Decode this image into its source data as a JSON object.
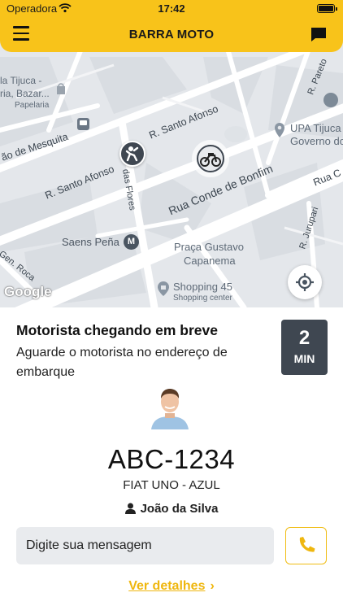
{
  "status_bar": {
    "carrier": "Operadora",
    "time": "17:42"
  },
  "header": {
    "title": "BARRA MOTO",
    "menu_icon": "hamburger-menu-icon",
    "chat_icon": "chat-bubble-icon",
    "color": "#f8c31a"
  },
  "map": {
    "labels": {
      "tijuca_bazar": "la Tijuca -",
      "tijuca_bazar2": "ria, Bazar...",
      "papelaria": "Papelaria",
      "mesquita": "ão de Mesquita",
      "santo_afonso_1": "R. Santo Afonso",
      "santo_afonso_2": "R. Santo Afonso",
      "das_flores": "das Flores",
      "conde_bonfim": "Rua Conde de Bonfim",
      "upa_1": "UPA Tijuca",
      "upa_2": "Governo do",
      "pareto": "R. Pareto",
      "rua_c": "Rua C",
      "jurupari": "R. Jurupari",
      "saens_pena": "Saens Peña",
      "metro_badge": "M",
      "gen_roca": "Gen. Roca",
      "praca_1": "Praça Gustavo",
      "praca_2": "Capanema",
      "shopping": "Shopping 45",
      "shopping_center": "Shopping center",
      "google": "Google"
    },
    "icons": [
      "bus-stop-icon",
      "passenger-pin-icon",
      "motorcycle-pin-icon",
      "location-pin-icon",
      "shopping-bag-icon",
      "metro-icon",
      "locate-me-icon"
    ]
  },
  "ride": {
    "status_title": "Motorista chegando em breve",
    "status_subtitle": "Aguarde o motorista no endereço de embarque",
    "eta_value": "2",
    "eta_unit": "MIN",
    "plate": "ABC-1234",
    "vehicle": "FIAT UNO - AZUL",
    "driver_name": "João da Silva"
  },
  "message": {
    "placeholder": "Digite sua mensagem"
  },
  "actions": {
    "details_label": "Ver detalhes",
    "call_icon": "phone-icon"
  },
  "colors": {
    "accent": "#f8c31a",
    "link": "#efb70f",
    "eta_bg": "#3f4751",
    "input_bg": "#e9ebee"
  }
}
